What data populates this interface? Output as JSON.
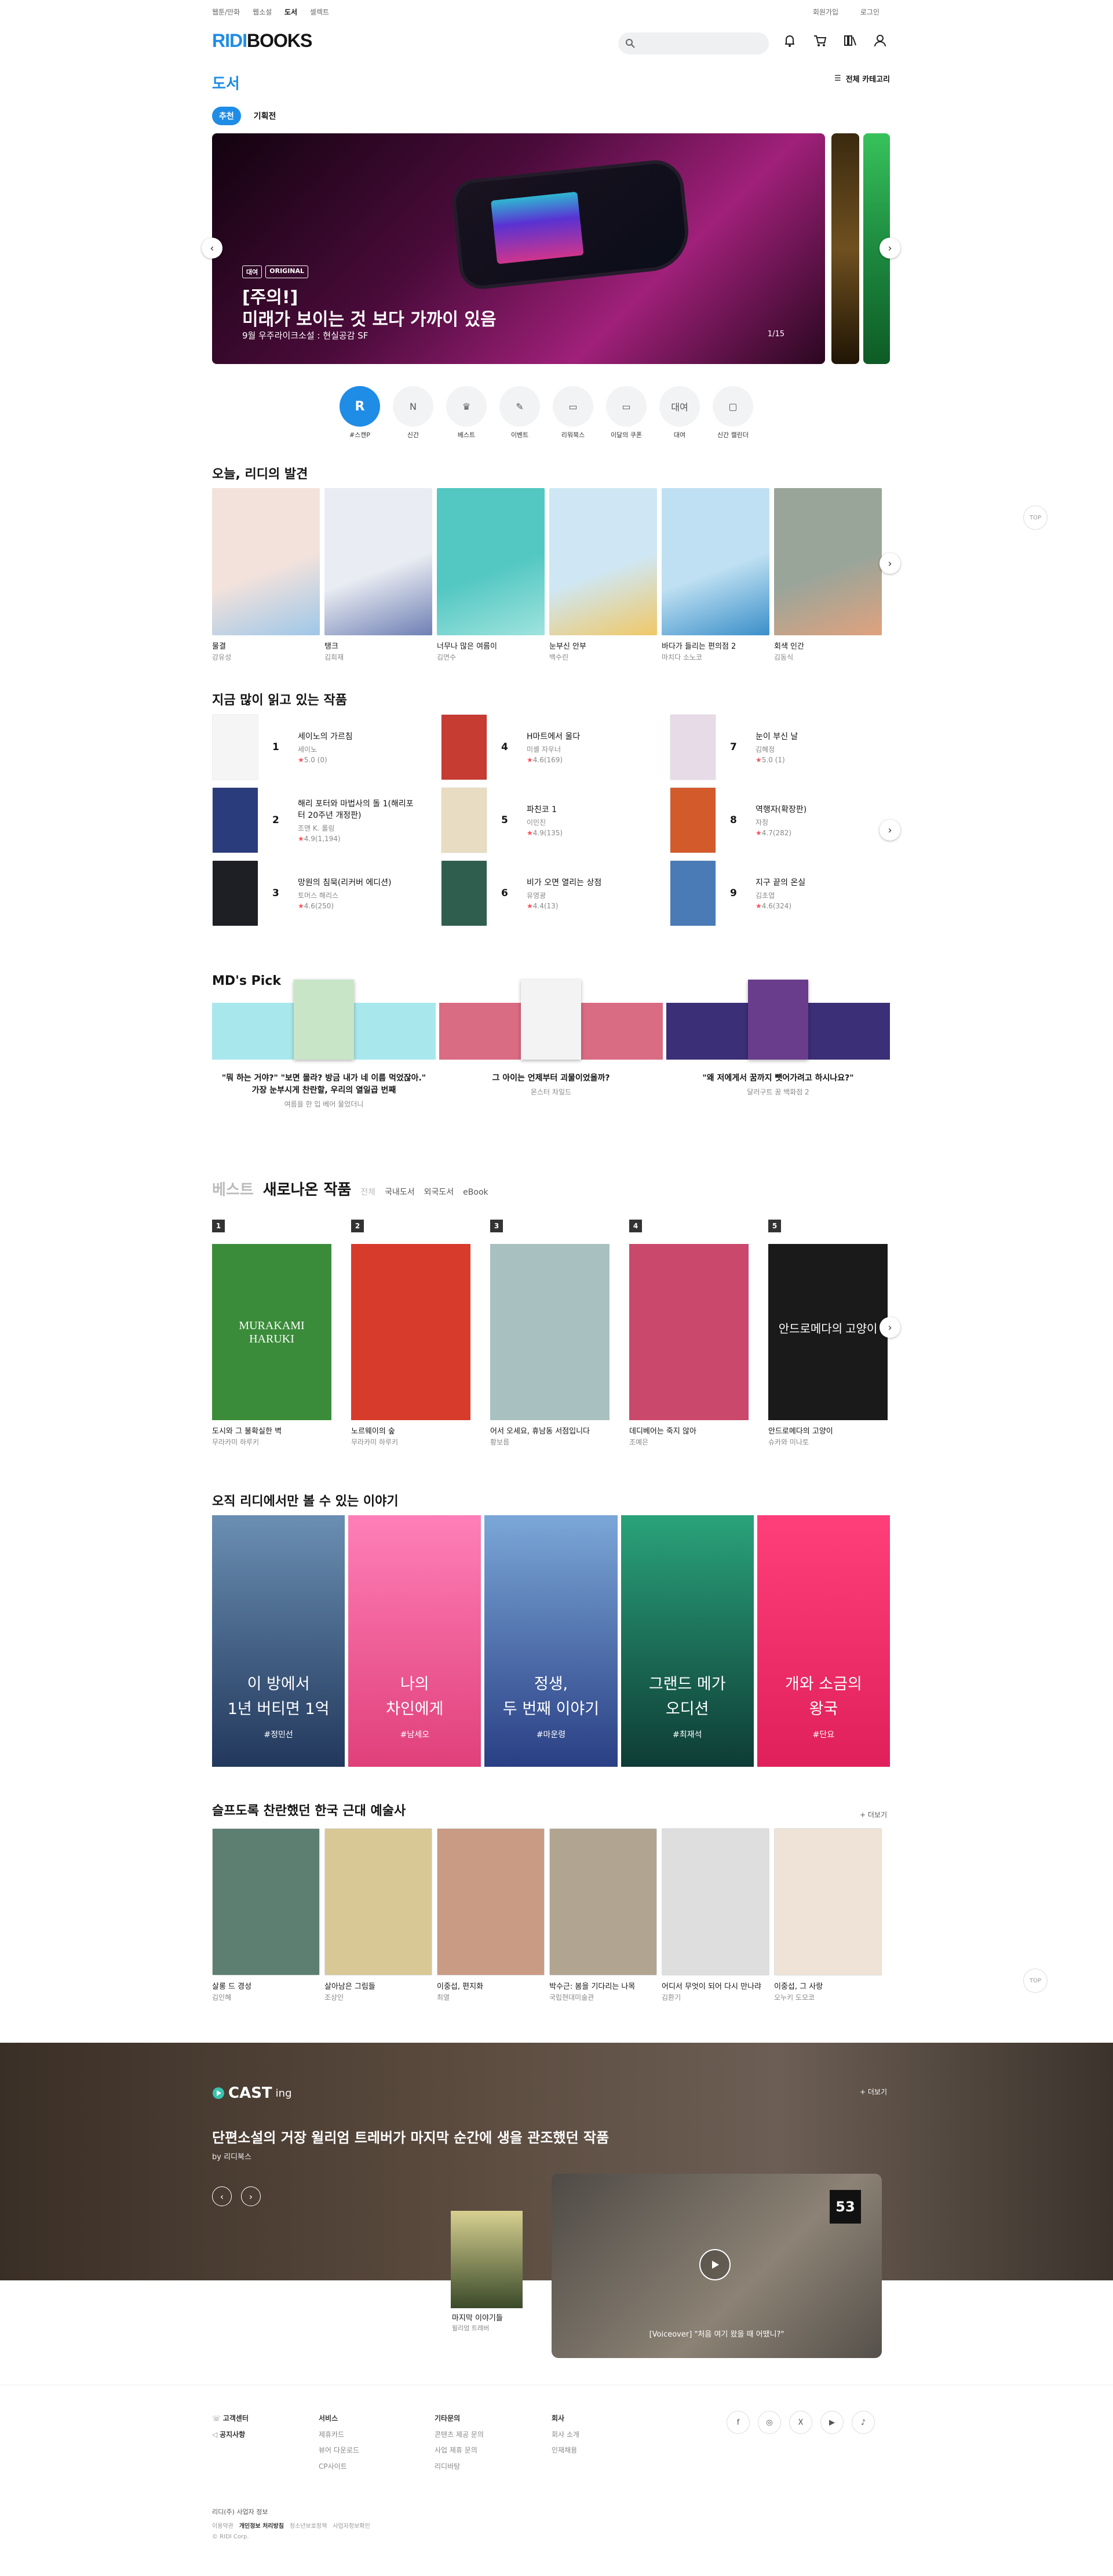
{
  "header": {
    "nav": [
      "웹툰/만화",
      "웹소설",
      "도서",
      "셀렉트"
    ],
    "active_nav": "도서",
    "links": [
      "회원가입",
      "로그인"
    ],
    "logo_part1": "RIDI",
    "logo_part2": "BOOKS",
    "search_placeholder": ""
  },
  "category": {
    "title": "도서",
    "all_label": "전체 카테고리"
  },
  "tabs": [
    "추천",
    "기획전"
  ],
  "hero": {
    "badges": [
      "대여",
      "ORIGINAL"
    ],
    "title1": "[주의!]",
    "title2": "미래가 보이는 것 보다 가까이 있음",
    "subtitle": "9월 우주라이크소설 : 현실공감 SF",
    "page": "1/15"
  },
  "quick_menu": [
    {
      "label": "#스캔P",
      "icon": "R"
    },
    {
      "label": "신간",
      "icon": "N"
    },
    {
      "label": "베스트",
      "icon": "♛"
    },
    {
      "label": "이벤트",
      "icon": "✎"
    },
    {
      "label": "리워북스",
      "icon": "▭"
    },
    {
      "label": "이달의 쿠폰",
      "icon": "▭"
    },
    {
      "label": "대여",
      "icon": "대여"
    },
    {
      "label": "신간 캘린더",
      "icon": "▢"
    }
  ],
  "discovery": {
    "title": "오늘, 리디의 발견",
    "books": [
      {
        "title": "물결",
        "author": "강유성",
        "color": "#f3e2dc",
        "accent": "#9ec7e8"
      },
      {
        "title": "탱크",
        "author": "김희재",
        "color": "#e9ecf2",
        "accent": "#6e7fb4"
      },
      {
        "title": "너무나 많은 여름이",
        "author": "김연수",
        "color": "#53c7c2",
        "accent": "#9fe3de"
      },
      {
        "title": "눈부신 안부",
        "author": "백수린",
        "color": "#cfe7f4",
        "accent": "#f0c867"
      },
      {
        "title": "바다가 들리는 편의점 2",
        "author": "마치다 소노코",
        "color": "#bfe0f2",
        "accent": "#3a8fc9"
      },
      {
        "title": "회색 인간",
        "author": "김동식",
        "color": "#9aa59a",
        "accent": "#e0a27e"
      }
    ]
  },
  "ranking": {
    "title": "지금 많이 읽고 있는 작품",
    "items": [
      {
        "rank": "1",
        "title": "세이노의 가르침",
        "author": "세이노",
        "rating": "5.0 (0)",
        "color": "#f5f5f5"
      },
      {
        "rank": "4",
        "title": "H마트에서 울다",
        "author": "미셸 자우너",
        "rating": "4.6(169)",
        "color": "#c63b32"
      },
      {
        "rank": "7",
        "title": "눈이 부신 날",
        "author": "김혜정",
        "rating": "5.0 (1)",
        "color": "#e7dbe8"
      },
      {
        "rank": "2",
        "title": "해리 포터와 마법사의 돌 1(해리포터 20주년 개정판)",
        "author": "조앤 K. 롤링",
        "rating": "4.9(1,194)",
        "color": "#2b3c7c"
      },
      {
        "rank": "5",
        "title": "파친코 1",
        "author": "이민진",
        "rating": "4.9(135)",
        "color": "#e8dcc2"
      },
      {
        "rank": "8",
        "title": "역행자(확장판)",
        "author": "자청",
        "rating": "4.7(282)",
        "color": "#d25a2b"
      },
      {
        "rank": "3",
        "title": "망원의 침묵(리커버 에디션)",
        "author": "토머스 해리스",
        "rating": "4.6(250)",
        "color": "#1d1f24"
      },
      {
        "rank": "6",
        "title": "비가 오면 열리는 상점",
        "author": "유영광",
        "rating": "4.4(13)",
        "color": "#2f5e4e"
      },
      {
        "rank": "9",
        "title": "지구 끝의 온실",
        "author": "김초엽",
        "rating": "4.6(324)",
        "color": "#4a7bb7"
      }
    ]
  },
  "mdpick": {
    "title": "MD's Pick",
    "items": [
      {
        "quote1": "\"뭐 하는 거야?\" \"보면 몰라? 방금 내가 네 이름 먹었잖아.\"",
        "quote2": "가장 눈부시게 찬란할, 우리의 열일곱 번째",
        "sub": "여름을 한 입 베어 물었더니",
        "bg": "#a8e8ed",
        "book": "#c9e5c8"
      },
      {
        "quote1": "그 아이는 언제부터 괴물이었을까?",
        "quote2": "",
        "sub": "몬스터 차일드",
        "bg": "#d96b82",
        "book": "#f3f3f3"
      },
      {
        "quote1": "\"왜 저에게서 꿈까지 뺏어가려고 하시나요?\"",
        "quote2": "",
        "sub": "달러구트 꿈 백화점 2",
        "bg": "#3b2f78",
        "book": "#6a3c8c"
      }
    ]
  },
  "best": {
    "title_gray": "베스트",
    "title": "새로나온 작품",
    "filters": [
      "전체",
      "국내도서",
      "외국도서",
      "eBook"
    ],
    "items": [
      {
        "rank": "1",
        "title": "도시와 그 불확실한 벽",
        "author": "무라카미 하루키",
        "bg": "#3b8c3a",
        "deco": "MURAKAMI HARUKI"
      },
      {
        "rank": "2",
        "title": "노르웨이의 숲",
        "author": "무라카미 하루키",
        "bg": "#d73b2c",
        "deco": ""
      },
      {
        "rank": "3",
        "title": "어서 오세요, 휴남동 서점입니다",
        "author": "황보름",
        "bg": "#a9c0c0",
        "deco": ""
      },
      {
        "rank": "4",
        "title": "데디베어는 죽지 않아",
        "author": "조예은",
        "bg": "#c9486b",
        "deco": ""
      },
      {
        "rank": "5",
        "title": "안드로메다의 고양이",
        "author": "슈카와 미나토",
        "bg": "#1a1a1a",
        "deco": "안드로메다의 고양이"
      }
    ]
  },
  "originals": {
    "title": "오직 리디에서만 볼 수 있는 이야기",
    "items": [
      {
        "t1": "이 방에서",
        "t2": "1년 버티면 1억",
        "tag": "#정민선",
        "bg1": "#6a8fb2",
        "bg2": "#22385c"
      },
      {
        "t1": "나의",
        "t2": "차인에게",
        "tag": "#남세오",
        "bg1": "#ff7fb8",
        "bg2": "#e0407a"
      },
      {
        "t1": "정생,",
        "t2": "두 번째 이야기",
        "tag": "#마운령",
        "bg1": "#7ba7d8",
        "bg2": "#2a3f84"
      },
      {
        "t1": "그랜드 메가",
        "t2": "오디션",
        "tag": "#최재석",
        "bg1": "#2aa37a",
        "bg2": "#0e3c36"
      },
      {
        "t1": "개와 소금의",
        "t2": "왕국",
        "tag": "#단요",
        "bg1": "#ff3f7a",
        "bg2": "#e0205a"
      }
    ]
  },
  "art": {
    "title": "슬프도록 찬란했던 한국 근대 예술사",
    "more": "+ 더보기",
    "items": [
      {
        "title": "살롱 드 경성",
        "author": "김인혜",
        "bg": "#5d7f72"
      },
      {
        "title": "살아남은 그림들",
        "author": "조상인",
        "bg": "#d8c896"
      },
      {
        "title": "이중섭, 편지화",
        "author": "최열",
        "bg": "#c99a84"
      },
      {
        "title": "박수근: 봄을 기다리는 나목",
        "author": "국립현대미술관",
        "bg": "#b1a491"
      },
      {
        "title": "어디서 무엇이 되어 다시 만나랴",
        "author": "김환기",
        "bg": "#dedede"
      },
      {
        "title": "이중섭, 그 사랑",
        "author": "오누키 도모코",
        "bg": "#eee3d6"
      }
    ]
  },
  "casting": {
    "logo": "CAST",
    "logo_suffix": "ing",
    "title": "단편소설의 거장 윌리엄 트레버가 마지막 순간에 생을 관조했던 작품",
    "by": "by 리디북스",
    "more": "+ 더보기",
    "book_title": "마지막 이야기들",
    "book_author": "윌리엄 트레버",
    "caption": "[Voiceover] \"처음 여기 왔을 때 어땠니?\"",
    "player_badge": "53"
  },
  "footer": {
    "cs": [
      "고객센터",
      "공지사항"
    ],
    "col1_title": "서비스",
    "col1": [
      "제휴카드",
      "뷰어 다운로드",
      "CP사이트"
    ],
    "col2_title": "기타문의",
    "col2": [
      "콘텐츠 제공 문의",
      "사업 제휴 문의",
      "리디바탕"
    ],
    "col3_title": "회사",
    "col3": [
      "회사 소개",
      "인재채용"
    ],
    "company": "리디(주) 사업자 정보",
    "legal": [
      "이용약관",
      "개인정보 처리방침",
      "청소년보호정책",
      "사업자정보확인"
    ],
    "copyright": "© RIDI Corp.",
    "social": [
      "f",
      "◎",
      "X",
      "▶",
      "♪"
    ]
  },
  "top_label": "TOP"
}
